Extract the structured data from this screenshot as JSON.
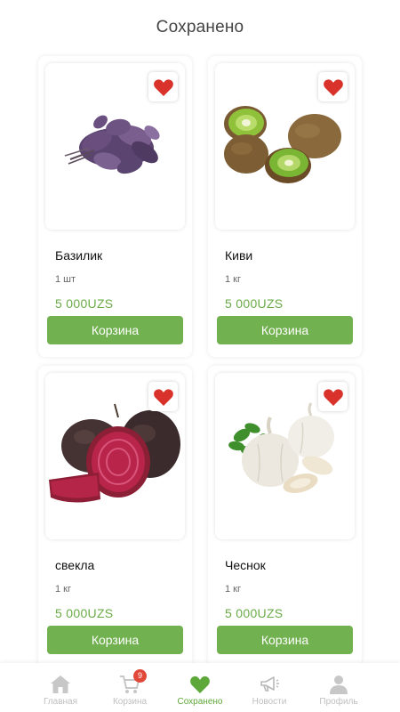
{
  "header": {
    "title": "Сохранено"
  },
  "products": [
    {
      "name": "Базилик",
      "unit": "1 шт",
      "price": "5 000UZS",
      "button": "Корзина",
      "image_icon": "basil",
      "favorite_icon": "heart-icon"
    },
    {
      "name": "Киви",
      "unit": "1 кг",
      "price": "5 000UZS",
      "button": "Корзина",
      "image_icon": "kiwi",
      "favorite_icon": "heart-icon"
    },
    {
      "name": "свекла",
      "unit": "1 кг",
      "price": "5 000UZS",
      "button": "Корзина",
      "image_icon": "beetroot",
      "favorite_icon": "heart-icon"
    },
    {
      "name": "Чеснок",
      "unit": "1 кг",
      "price": "5 000UZS",
      "button": "Корзина",
      "image_icon": "garlic",
      "favorite_icon": "heart-icon"
    }
  ],
  "nav": {
    "items": [
      {
        "label": "Главная",
        "icon": "home-icon"
      },
      {
        "label": "Корзина",
        "icon": "cart-icon",
        "badge": "9"
      },
      {
        "label": "Сохранено",
        "icon": "heart-icon"
      },
      {
        "label": "Новости",
        "icon": "megaphone-icon"
      },
      {
        "label": "Профиль",
        "icon": "user-icon"
      }
    ],
    "active": "Сохранено"
  },
  "colors": {
    "accent_green": "#71b14f",
    "price_green": "#6aab47",
    "heart_red": "#d9322b",
    "badge_red": "#e1483a",
    "inactive_gray": "#bfbfbf"
  }
}
